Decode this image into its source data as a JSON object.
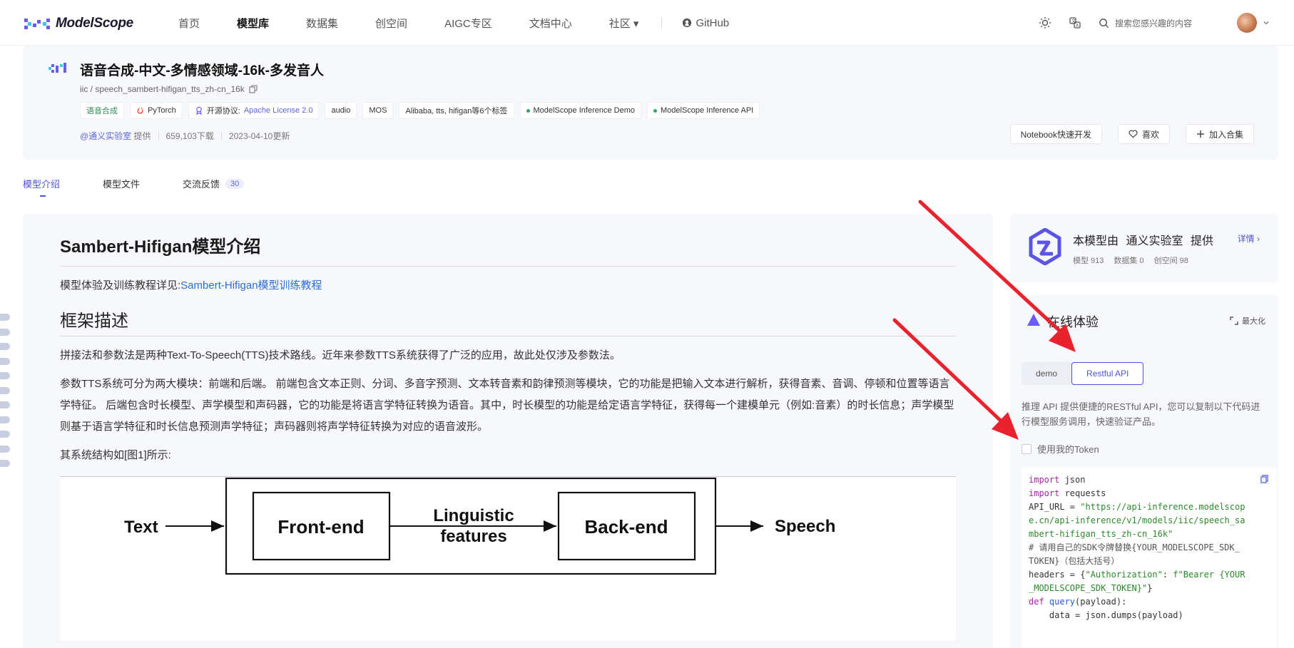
{
  "nav": {
    "logo_text": "ModelScope",
    "items": [
      "首页",
      "模型库",
      "数据集",
      "创空间",
      "AIGC专区",
      "文档中心",
      "社区 ▾"
    ],
    "github": "GitHub",
    "search_placeholder": "搜索您感兴趣的内容"
  },
  "model": {
    "title": "语音合成-中文-多情感领域-16k-多发音人",
    "path": "iic / speech_sambert-hifigan_tts_zh-cn_16k",
    "tags": {
      "task": "语音合成",
      "framework": "PyTorch",
      "license_label": "开源协议:",
      "license_value": "Apache License 2.0",
      "audio": "audio",
      "mos": "MOS",
      "more": "Alibaba, tts, hifigan等6个标签",
      "demo": "ModelScope Inference Demo",
      "api": "ModelScope Inference API"
    },
    "meta": {
      "provider": "@通义实验室",
      "provider_suffix": "提供",
      "downloads": "659,103下载",
      "updated": "2023-04-10更新"
    },
    "actions": {
      "notebook": "Notebook快速开发",
      "like": "喜欢",
      "collect": "加入合集"
    }
  },
  "tabs": {
    "intro": "模型介绍",
    "files": "模型文件",
    "feedback": "交流反馈",
    "feedback_count": "30"
  },
  "doc": {
    "h1": "Sambert-Hifigan模型介绍",
    "p1_prefix": "模型体验及训练教程详见:",
    "p1_link": "Sambert-Hifigan模型训练教程",
    "h2": "框架描述",
    "p2": "拼接法和参数法是两种Text-To-Speech(TTS)技术路线。近年来参数TTS系统获得了广泛的应用，故此处仅涉及参数法。",
    "p3": "参数TTS系统可分为两大模块：前端和后端。 前端包含文本正则、分词、多音字预测、文本转音素和韵律预测等模块，它的功能是把输入文本进行解析，获得音素、音调、停顿和位置等语言学特征。 后端包含时长模型、声学模型和声码器，它的功能是将语言学特征转换为语音。其中，时长模型的功能是给定语言学特征，获得每一个建模单元（例如:音素）的时长信息；声学模型则基于语言学特征和时长信息预测声学特征；声码器则将声学特征转换为对应的语音波形。",
    "p4": "其系统结构如[图1]所示:",
    "diagram": {
      "text": "Text",
      "frontend": "Front-end",
      "linguistic_1": "Linguistic",
      "linguistic_2": "features",
      "backend": "Back-end",
      "speech": "Speech"
    }
  },
  "provider": {
    "prefix": "本模型由",
    "name": "通义实验室",
    "suffix": "提供",
    "detail": "详情",
    "models": "模型 913",
    "datasets": "数据集 0",
    "spaces": "创空间 98"
  },
  "online": {
    "title": "在线体验",
    "maximize": "最大化",
    "tab_demo": "demo",
    "tab_api": "Restful API",
    "desc": "推理 API 提供便捷的RESTful API，您可以复制以下代码进行模型服务调用，快速验证产品。",
    "token": "使用我的Token"
  },
  "code": {
    "l1_kw": "import",
    "l1_rest": " json",
    "l2_kw": "import",
    "l2_rest": " requests",
    "l3_a": "API_URL = ",
    "l3_s": "\"https://api-inference.modelscop",
    "l4": "e.cn/api-inference/v1/models/iic/speech_sa",
    "l5": "mbert-hifigan_tts_zh-cn_16k\"",
    "l6": "# 请用自己的SDK令牌替换{YOUR_MODELSCOPE_SDK_",
    "l7": "TOKEN}（包括大括号）",
    "l8_a": "headers = {",
    "l8_s": "\"Authorization\"",
    "l8_b": ": ",
    "l8_s2": "f\"Bearer {YOUR",
    "l9_s": "_MODELSCOPE_SDK_TOKEN}\"",
    "l9_b": "}",
    "l10_kw": "def",
    "l10_fn": " query",
    "l10_rest": "(payload):",
    "l11": "    data = json.dumps(payload)"
  },
  "colors": {
    "accent": "#4d55d6",
    "link": "#2a6fd1",
    "arrow": "#e8232d"
  }
}
